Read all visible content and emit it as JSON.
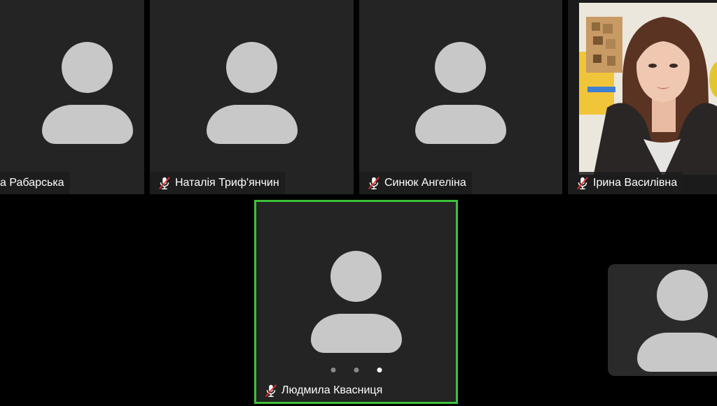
{
  "participants": [
    {
      "name": "а Рабарська",
      "muted": false
    },
    {
      "name": "Наталія Триф'янчин",
      "muted": true
    },
    {
      "name": "Синюк Ангеліна",
      "muted": true
    },
    {
      "name": "Ірина Василівна",
      "muted": true,
      "video": true
    },
    {
      "name": "Людмила Квасниця",
      "muted": true,
      "active_speaker": true
    }
  ],
  "pagination": {
    "total": 3,
    "current": 3
  },
  "colors": {
    "tile_bg": "#242424",
    "avatar": "#c8c8c8",
    "active_border": "#3cc13b",
    "muted_slash": "#e0322f"
  },
  "icons": {
    "muted": "microphone-muted-icon",
    "avatar": "default-avatar-icon"
  }
}
